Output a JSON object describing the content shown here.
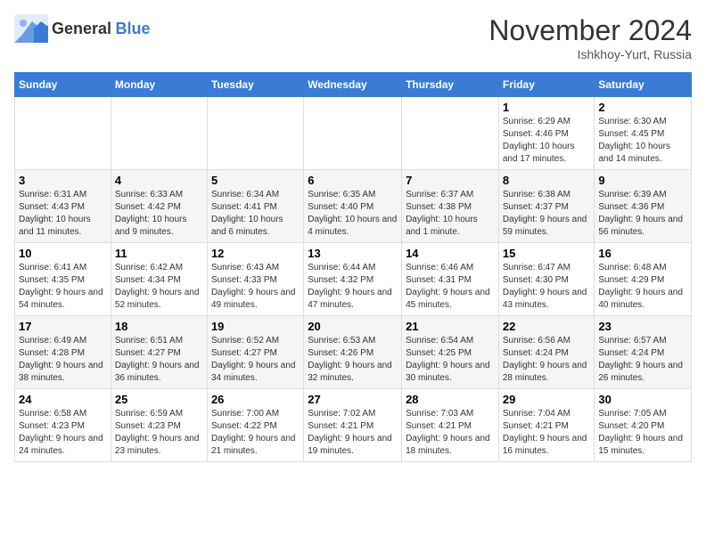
{
  "header": {
    "logo_general": "General",
    "logo_blue": "Blue",
    "month": "November 2024",
    "location": "Ishkhoy-Yurt, Russia"
  },
  "days_of_week": [
    "Sunday",
    "Monday",
    "Tuesday",
    "Wednesday",
    "Thursday",
    "Friday",
    "Saturday"
  ],
  "weeks": [
    [
      {
        "day": "",
        "info": ""
      },
      {
        "day": "",
        "info": ""
      },
      {
        "day": "",
        "info": ""
      },
      {
        "day": "",
        "info": ""
      },
      {
        "day": "",
        "info": ""
      },
      {
        "day": "1",
        "info": "Sunrise: 6:29 AM\nSunset: 4:46 PM\nDaylight: 10 hours and 17 minutes."
      },
      {
        "day": "2",
        "info": "Sunrise: 6:30 AM\nSunset: 4:45 PM\nDaylight: 10 hours and 14 minutes."
      }
    ],
    [
      {
        "day": "3",
        "info": "Sunrise: 6:31 AM\nSunset: 4:43 PM\nDaylight: 10 hours and 11 minutes."
      },
      {
        "day": "4",
        "info": "Sunrise: 6:33 AM\nSunset: 4:42 PM\nDaylight: 10 hours and 9 minutes."
      },
      {
        "day": "5",
        "info": "Sunrise: 6:34 AM\nSunset: 4:41 PM\nDaylight: 10 hours and 6 minutes."
      },
      {
        "day": "6",
        "info": "Sunrise: 6:35 AM\nSunset: 4:40 PM\nDaylight: 10 hours and 4 minutes."
      },
      {
        "day": "7",
        "info": "Sunrise: 6:37 AM\nSunset: 4:38 PM\nDaylight: 10 hours and 1 minute."
      },
      {
        "day": "8",
        "info": "Sunrise: 6:38 AM\nSunset: 4:37 PM\nDaylight: 9 hours and 59 minutes."
      },
      {
        "day": "9",
        "info": "Sunrise: 6:39 AM\nSunset: 4:36 PM\nDaylight: 9 hours and 56 minutes."
      }
    ],
    [
      {
        "day": "10",
        "info": "Sunrise: 6:41 AM\nSunset: 4:35 PM\nDaylight: 9 hours and 54 minutes."
      },
      {
        "day": "11",
        "info": "Sunrise: 6:42 AM\nSunset: 4:34 PM\nDaylight: 9 hours and 52 minutes."
      },
      {
        "day": "12",
        "info": "Sunrise: 6:43 AM\nSunset: 4:33 PM\nDaylight: 9 hours and 49 minutes."
      },
      {
        "day": "13",
        "info": "Sunrise: 6:44 AM\nSunset: 4:32 PM\nDaylight: 9 hours and 47 minutes."
      },
      {
        "day": "14",
        "info": "Sunrise: 6:46 AM\nSunset: 4:31 PM\nDaylight: 9 hours and 45 minutes."
      },
      {
        "day": "15",
        "info": "Sunrise: 6:47 AM\nSunset: 4:30 PM\nDaylight: 9 hours and 43 minutes."
      },
      {
        "day": "16",
        "info": "Sunrise: 6:48 AM\nSunset: 4:29 PM\nDaylight: 9 hours and 40 minutes."
      }
    ],
    [
      {
        "day": "17",
        "info": "Sunrise: 6:49 AM\nSunset: 4:28 PM\nDaylight: 9 hours and 38 minutes."
      },
      {
        "day": "18",
        "info": "Sunrise: 6:51 AM\nSunset: 4:27 PM\nDaylight: 9 hours and 36 minutes."
      },
      {
        "day": "19",
        "info": "Sunrise: 6:52 AM\nSunset: 4:27 PM\nDaylight: 9 hours and 34 minutes."
      },
      {
        "day": "20",
        "info": "Sunrise: 6:53 AM\nSunset: 4:26 PM\nDaylight: 9 hours and 32 minutes."
      },
      {
        "day": "21",
        "info": "Sunrise: 6:54 AM\nSunset: 4:25 PM\nDaylight: 9 hours and 30 minutes."
      },
      {
        "day": "22",
        "info": "Sunrise: 6:56 AM\nSunset: 4:24 PM\nDaylight: 9 hours and 28 minutes."
      },
      {
        "day": "23",
        "info": "Sunrise: 6:57 AM\nSunset: 4:24 PM\nDaylight: 9 hours and 26 minutes."
      }
    ],
    [
      {
        "day": "24",
        "info": "Sunrise: 6:58 AM\nSunset: 4:23 PM\nDaylight: 9 hours and 24 minutes."
      },
      {
        "day": "25",
        "info": "Sunrise: 6:59 AM\nSunset: 4:23 PM\nDaylight: 9 hours and 23 minutes."
      },
      {
        "day": "26",
        "info": "Sunrise: 7:00 AM\nSunset: 4:22 PM\nDaylight: 9 hours and 21 minutes."
      },
      {
        "day": "27",
        "info": "Sunrise: 7:02 AM\nSunset: 4:21 PM\nDaylight: 9 hours and 19 minutes."
      },
      {
        "day": "28",
        "info": "Sunrise: 7:03 AM\nSunset: 4:21 PM\nDaylight: 9 hours and 18 minutes."
      },
      {
        "day": "29",
        "info": "Sunrise: 7:04 AM\nSunset: 4:21 PM\nDaylight: 9 hours and 16 minutes."
      },
      {
        "day": "30",
        "info": "Sunrise: 7:05 AM\nSunset: 4:20 PM\nDaylight: 9 hours and 15 minutes."
      }
    ]
  ]
}
